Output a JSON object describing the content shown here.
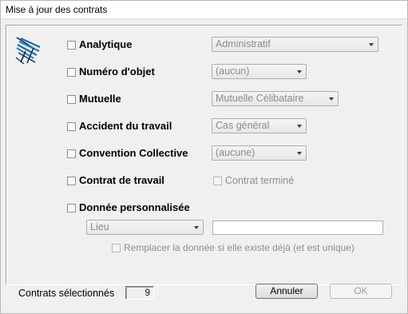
{
  "window": {
    "title": "Mise à jour des contrats"
  },
  "options": [
    {
      "label": "Analytique",
      "combo_value": "Administratif"
    },
    {
      "label": "Numéro d'objet",
      "combo_value": "(aucun)"
    },
    {
      "label": "Mutuelle",
      "combo_value": "Mutuelle Célibataire"
    },
    {
      "label": "Accident du travail",
      "combo_value": "Cas général"
    },
    {
      "label": "Convention Collective",
      "combo_value": "(aucune)"
    },
    {
      "label": "Contrat de travail",
      "sub_checkbox_label": "Contrat terminé"
    },
    {
      "label": "Donnée personnalisée",
      "combo_value": "Lieu",
      "text_value": ""
    }
  ],
  "replace_label": "Remplacer la donnée si elle existe déjà (et est unique)",
  "footer": {
    "selected_label": "Contrats sélectionnés",
    "selected_count": "9",
    "cancel_label": "Annuler",
    "ok_label": "OK"
  },
  "colors": {
    "logo_blue": "#1c6fa8",
    "logo_dark": "#0b2f55"
  }
}
